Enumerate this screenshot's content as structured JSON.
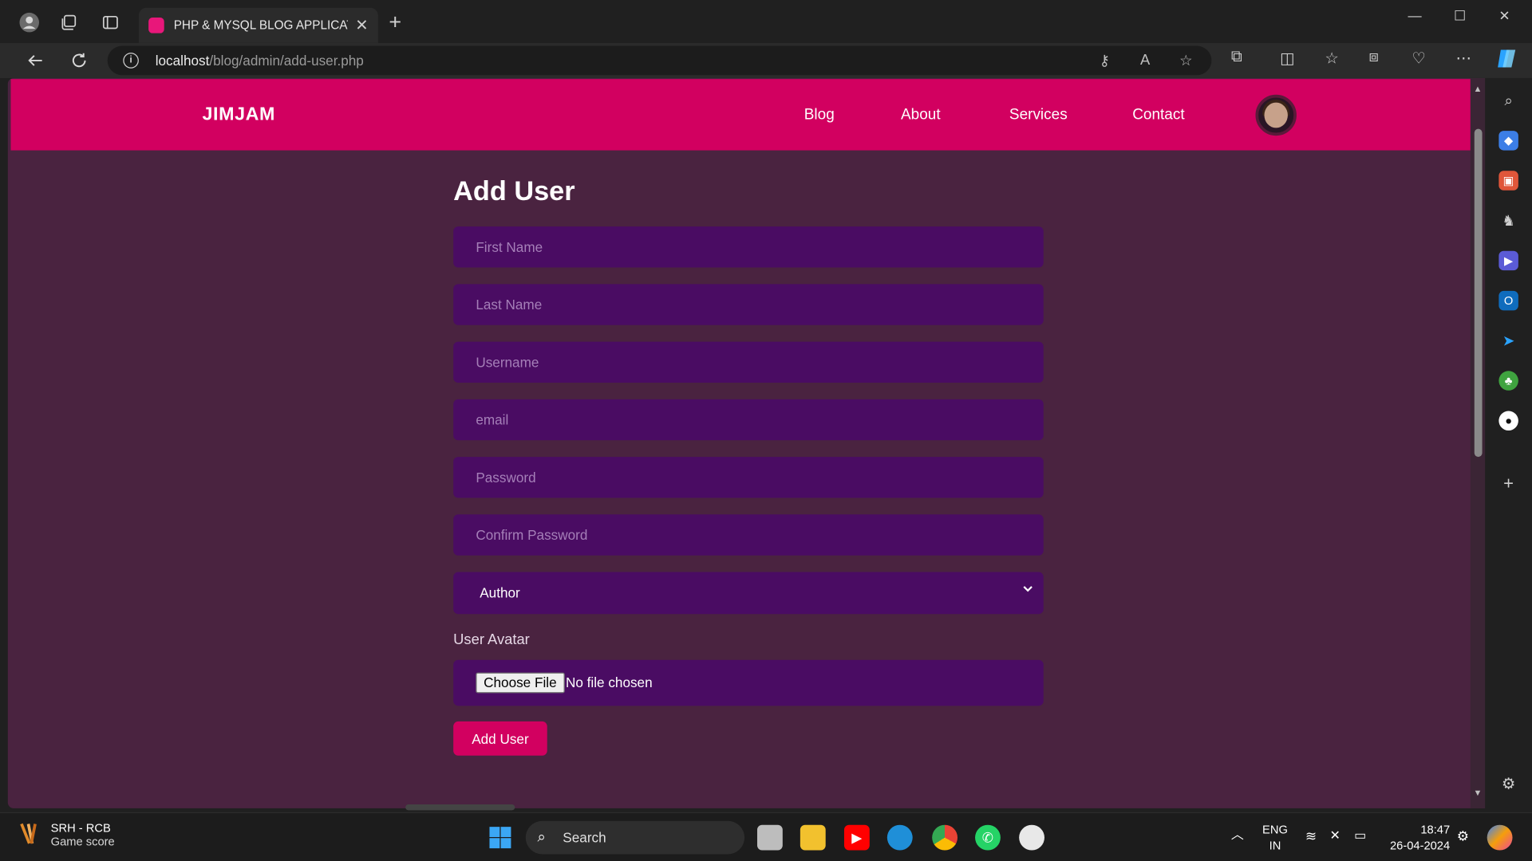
{
  "browser": {
    "tab_title": "PHP & MYSQL BLOG APPLICATIO",
    "url_host": "localhost",
    "url_path": "/blog/admin/add-user.php"
  },
  "site": {
    "logo": "JIMJAM",
    "nav": [
      "Blog",
      "About",
      "Services",
      "Contact"
    ]
  },
  "form": {
    "title": "Add User",
    "first_name_placeholder": "First Name",
    "last_name_placeholder": "Last Name",
    "username_placeholder": "Username",
    "email_placeholder": "email",
    "password_placeholder": "Password",
    "confirm_password_placeholder": "Confirm Password",
    "role_selected": "Author",
    "avatar_label": "User Avatar",
    "file_button": "Choose File",
    "file_status": "No file chosen",
    "submit_label": "Add User"
  },
  "taskbar": {
    "widget_title": "SRH - RCB",
    "widget_sub": "Game score",
    "search_label": "Search",
    "lang_line1": "ENG",
    "lang_line2": "IN",
    "time": "18:47",
    "date": "26-04-2024"
  },
  "colors": {
    "header": "#d20060",
    "page_bg": "#4a2340",
    "field_bg": "#4a0c63",
    "button": "#d20060"
  }
}
